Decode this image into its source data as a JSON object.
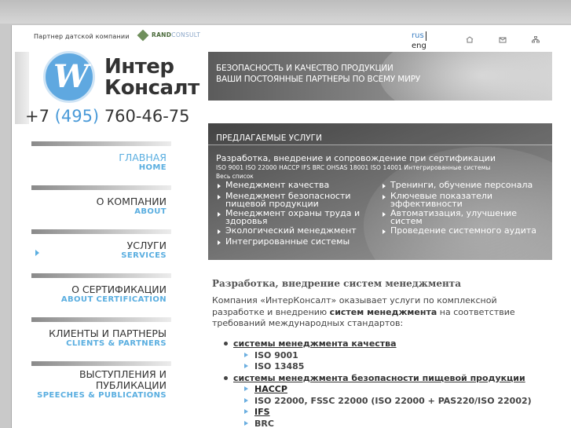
{
  "header": {
    "partner_text": "Партнер датской компании",
    "rand_logo_main": "RAND",
    "rand_logo_sub": "CONSULT",
    "lang_rus": "rus",
    "lang_eng": "eng",
    "icons": [
      "home-icon",
      "mail-icon",
      "sitemap-icon"
    ]
  },
  "logo": {
    "letter": "W",
    "name_line1": "Интер",
    "name_line2": "Консалт",
    "phone_prefix": "+7",
    "phone_code": "(495)",
    "phone_number": "760-46-75"
  },
  "menu": [
    {
      "ru": "ГЛАВНАЯ",
      "en": "HOME",
      "active": true
    },
    {
      "ru": "О КОМПАНИИ",
      "en": "ABOUT",
      "active": false
    },
    {
      "ru": "УСЛУГИ",
      "en": "SERVICES",
      "active": false
    },
    {
      "ru": "О СЕРТИФИКАЦИИ",
      "en": "ABOUT CERTIFICATION",
      "active": false
    },
    {
      "ru": "КЛИЕНТЫ И ПАРТНЕРЫ",
      "en": "CLIENTS & PARTNERS",
      "active": false
    },
    {
      "ru_line1": "ВЫСТУПЛЕНИЯ И",
      "ru_line2": "ПУБЛИКАЦИИ",
      "en": "SPEECHES & PUBLICATIONS",
      "active": false
    }
  ],
  "banner": {
    "line1": "БЕЗОПАСНОСТЬ И КАЧЕСТВО ПРОДУКЦИИ",
    "line2": "ВАШИ ПОСТОЯННЫЕ ПАРТНЕРЫ ПО ВСЕМУ МИРУ"
  },
  "services": {
    "title": "ПРЕДЛАГАЕМЫЕ УСЛУГИ",
    "subtitle": "Разработка, внедрение и сопровождение при сертификации",
    "standards": "ISO 9001  ISO 22000  HACCP  IFS  BRC  OHSAS 18001  ISO 14001  Интегрированные системы",
    "all_link": "Весь список",
    "left": [
      "Менеджмент качества",
      "Менеджмент безопасности пищевой продукции",
      "Менеджмент охраны труда и здоровья",
      "Экологический менеджмент",
      "Интегрированные системы"
    ],
    "right": [
      "Тренинги, обучение персонала",
      "Ключевые показатели эффективности",
      "Автоматизация, улучшение систем",
      "Проведение системного аудита"
    ]
  },
  "main": {
    "title": "Разработка, внедрение систем менеджмента",
    "text_a": "Компания «ИнтерКонсалт» оказывает услуги по комплексной разработке и внедрению ",
    "text_bold": "систем менеджмента",
    "text_b": " на соответствие требований международных стандартов:",
    "list": [
      {
        "label": "системы менеджмента качества",
        "sub": [
          {
            "label": "ISO 9001",
            "underline": false
          },
          {
            "label": "ISO 13485",
            "underline": false
          }
        ]
      },
      {
        "label": "системы менеджмента безопасности пищевой продукции",
        "sub": [
          {
            "label": "HACCP",
            "underline": true
          },
          {
            "label": "ISO 22000, FSSC 22000 (ISO 22000 + PAS220/ISO 22002)",
            "underline": false
          },
          {
            "label": "IFS",
            "underline": true
          },
          {
            "label": "BRC",
            "underline": false
          }
        ]
      }
    ]
  }
}
